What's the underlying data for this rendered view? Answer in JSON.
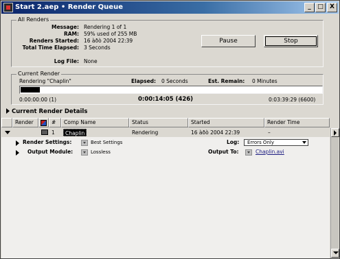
{
  "window": {
    "title": "Start 2.aep • Render Queue",
    "minimize_glyph": "_",
    "maximize_glyph": "□",
    "close_glyph": "X"
  },
  "all_renders": {
    "group_label": "All Renders",
    "message_label": "Message:",
    "message_value": "Rendering 1 of 1",
    "ram_label": "RAM:",
    "ram_value": "59% used of 255 MB",
    "started_label": "Renders Started:",
    "started_value": "16 àðò 2004 22:39",
    "elapsed_label": "Total Time Elapsed:",
    "elapsed_value": "3  Seconds",
    "logfile_label": "Log File:",
    "logfile_value": "None",
    "pause_label": "Pause",
    "stop_label": "Stop"
  },
  "current_render": {
    "group_label": "Current Render",
    "rendering_text": "Rendering \"Chaplin\"",
    "elapsed_label": "Elapsed:",
    "elapsed_value": "0  Seconds",
    "remain_label": "Est. Remain:",
    "remain_value": "0 Minutes",
    "progress_fraction": 0.063,
    "start_time": "0:00:00:00 (1)",
    "current_time": "0:00:14:05 (426)",
    "end_time": "0:03:39:29 (6600)"
  },
  "details": {
    "header": "Current Render Details"
  },
  "table": {
    "columns": [
      "Render",
      "#",
      "Comp Name",
      "Status",
      "Started",
      "Render Time"
    ],
    "row": {
      "number": "1",
      "comp_name": "Chaplin",
      "status": "Rendering",
      "started": "16 àðò 2004 22:39",
      "render_time": "–"
    }
  },
  "row_details": {
    "render_settings_label": "Render Settings:",
    "render_settings_value": "Best Settings",
    "output_module_label": "Output Module:",
    "output_module_value": "Lossless",
    "log_label": "Log:",
    "log_value": "Errors Only",
    "output_to_label": "Output To:",
    "output_to_value": "Chaplin.avi"
  }
}
